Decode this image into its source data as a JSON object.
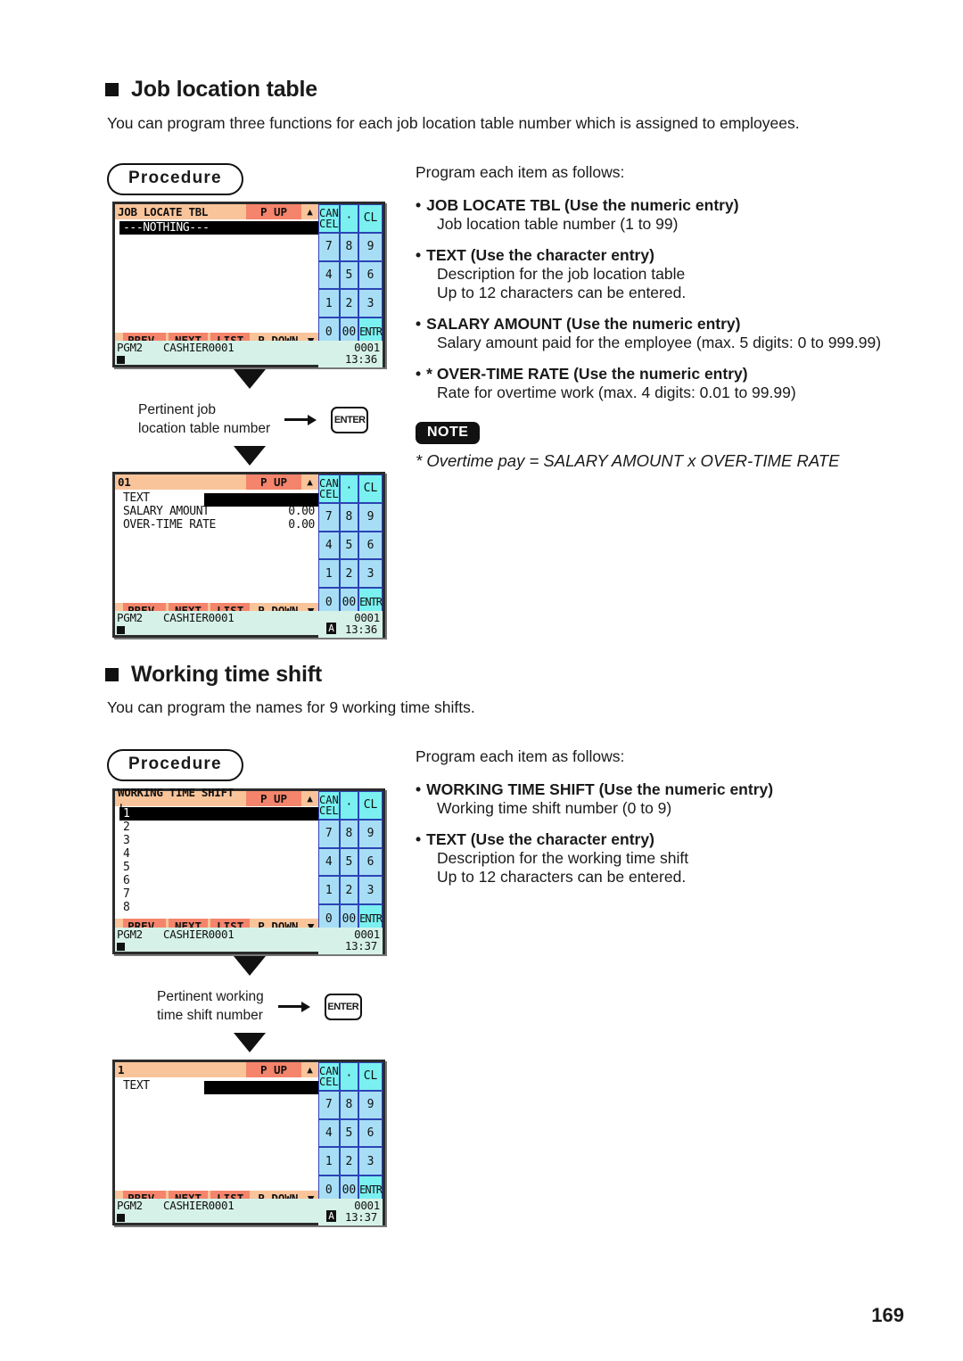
{
  "page": {
    "number": "169"
  },
  "sections": [
    {
      "id": "job-location-table",
      "heading": "Job location table",
      "intro": "You can program three functions for each job location table number which is assigned to employees.",
      "procedure_label": "Procedure",
      "right_intro": "Program each item as follows:",
      "items": [
        {
          "bullet": "•",
          "title": "JOB LOCATE TBL (Use the numeric entry)",
          "subs": [
            "Job location table number (1 to 99)"
          ]
        },
        {
          "bullet": "•",
          "title": "TEXT (Use the character entry)",
          "subs": [
            "Description for the job location table",
            "Up to 12 characters can be entered."
          ]
        },
        {
          "bullet": "•",
          "title": "SALARY AMOUNT (Use the numeric entry)",
          "subs": [
            "Salary amount paid for the employee (max. 5 digits: 0 to 999.99)"
          ]
        },
        {
          "bullet": "•",
          "title": "* OVER-TIME RATE (Use the numeric entry)",
          "subs": [
            "Rate for overtime work (max. 4 digits: 0.01 to 99.99)"
          ]
        }
      ],
      "note": {
        "label": "NOTE",
        "text": "* Overtime pay = SALARY AMOUNT x OVER-TIME RATE"
      },
      "annotation": {
        "line1": "Pertinent job",
        "line2": "location table number",
        "key": "ENTER"
      }
    },
    {
      "id": "working-time-shift",
      "heading": "Working time shift",
      "intro": "You can program the names for 9 working time shifts.",
      "procedure_label": "Procedure",
      "right_intro": "Program each item as follows:",
      "items": [
        {
          "bullet": "•",
          "title": "WORKING TIME SHIFT (Use the numeric entry)",
          "subs": [
            "Working time shift number (0 to 9)"
          ]
        },
        {
          "bullet": "•",
          "title": "TEXT (Use the character entry)",
          "subs": [
            "Description for the working time shift",
            "Up to 12 characters can be entered."
          ]
        }
      ],
      "annotation": {
        "line1": "Pertinent working",
        "line2": "time shift number",
        "key": "ENTER"
      }
    }
  ],
  "keypad": {
    "rows": [
      [
        {
          "label": "CAN\nCEL",
          "name": "cancel"
        },
        {
          "label": "·",
          "name": "decimal"
        },
        {
          "label": "CL",
          "name": "clear"
        }
      ],
      [
        {
          "label": "7"
        },
        {
          "label": "8"
        },
        {
          "label": "9"
        }
      ],
      [
        {
          "label": "4"
        },
        {
          "label": "5"
        },
        {
          "label": "6"
        }
      ],
      [
        {
          "label": "1"
        },
        {
          "label": "2"
        },
        {
          "label": "3"
        }
      ],
      [
        {
          "label": "0"
        },
        {
          "label": "00"
        },
        {
          "label": "ENTR",
          "name": "enter"
        }
      ]
    ],
    "cancel_top": "CAN",
    "cancel_bottom": "CEL",
    "decimal": "·",
    "clear": "CL",
    "k7": "7",
    "k8": "8",
    "k9": "9",
    "k4": "4",
    "k5": "5",
    "k6": "6",
    "k1": "1",
    "k2": "2",
    "k3": "3",
    "k0": "0",
    "k00": "00",
    "entr": "ENTR"
  },
  "softkeys": {
    "prev": "PREV.",
    "next": "NEXT",
    "list": "LIST",
    "pdown": "P DOWN",
    "pup": "P UP",
    "caret_up": "▲",
    "caret_down": "▼"
  },
  "screens": {
    "job_list": {
      "title": "JOB LOCATE TBL",
      "rows": [
        {
          "label": "---NOTHING---",
          "selected": true
        }
      ],
      "status": {
        "mode": "PGM2",
        "cashier": "CASHIER0001",
        "counter": "0001",
        "time": "13:36"
      }
    },
    "job_detail": {
      "title": "01",
      "rows": [
        {
          "label": "TEXT",
          "value": "",
          "field": true
        },
        {
          "label": "SALARY AMOUNT",
          "value": "0.00"
        },
        {
          "label": "OVER-TIME RATE",
          "value": "0.00"
        }
      ],
      "status": {
        "mode": "PGM2",
        "cashier": "CASHIER0001",
        "counter": "0001",
        "time": "13:36",
        "badge": "A"
      }
    },
    "shift_list": {
      "title": "WORKING TIME SHIFT ↓",
      "rows": [
        {
          "label": "1",
          "selected": true
        },
        {
          "label": "2"
        },
        {
          "label": "3"
        },
        {
          "label": "4"
        },
        {
          "label": "5"
        },
        {
          "label": "6"
        },
        {
          "label": "7"
        },
        {
          "label": "8"
        }
      ],
      "status": {
        "mode": "PGM2",
        "cashier": "CASHIER0001",
        "counter": "0001",
        "time": "13:37"
      }
    },
    "shift_detail": {
      "title": "1",
      "rows": [
        {
          "label": "TEXT",
          "value": "",
          "field": true
        }
      ],
      "status": {
        "mode": "PGM2",
        "cashier": "CASHIER0001",
        "counter": "0001",
        "time": "13:37",
        "badge": "A"
      }
    }
  },
  "colors": {
    "header_bar": "#f9c49a",
    "accent_key": "#f4846b",
    "keypad_blue": "#a7def5",
    "keypad_cyan": "#7af0f0",
    "status_bg": "#d6f2e8"
  }
}
